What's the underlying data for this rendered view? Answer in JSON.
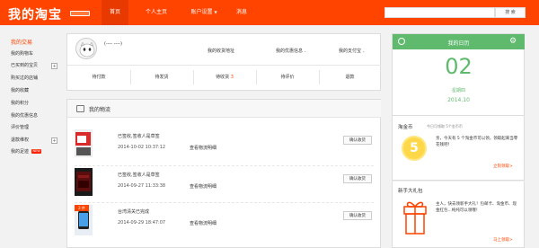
{
  "header": {
    "logo": "我的淘宝",
    "logo_badge": "",
    "nav": [
      {
        "label": "首页",
        "active": true
      },
      {
        "label": "个人主页",
        "active": false
      },
      {
        "label": "账户设置",
        "active": false
      },
      {
        "label": "消息",
        "active": false
      }
    ],
    "search_button": "搜 索",
    "search_value": ""
  },
  "sidebar": {
    "title": "我的交易",
    "items": [
      {
        "label": "我的购物车"
      },
      {
        "label": "已买到的宝贝"
      },
      {
        "label": "购买过的店铺"
      },
      {
        "label": "我的收藏"
      },
      {
        "label": "我的积分"
      },
      {
        "label": "我的优惠信息"
      },
      {
        "label": "评价管理"
      },
      {
        "label": "退款维权"
      },
      {
        "label": "我的足迹"
      }
    ],
    "new_badge": "NEW"
  },
  "profile": {
    "username": "(---- ----)",
    "links": [
      "我的收货地址",
      "我的优惠信息",
      "我的支付宝"
    ],
    "orders": [
      {
        "label": "待付款",
        "count": ""
      },
      {
        "label": "待发货",
        "count": ""
      },
      {
        "label": "待收货",
        "count": "3"
      },
      {
        "label": "待评价",
        "count": ""
      },
      {
        "label": "退款",
        "count": ""
      }
    ]
  },
  "logistics": {
    "title": "我的物流",
    "items": [
      {
        "status": "已签收,签收人是草签",
        "time": "2014-10-02 10:37:12",
        "link": "查看物流明细",
        "button": "确认收货",
        "badge": ""
      },
      {
        "status": "已签收,签收人是草签",
        "time": "2014-09-27 11:33:38",
        "link": "查看物流明细",
        "button": "确认收货",
        "badge": ""
      },
      {
        "status": "台湾清关已完成",
        "time": "2014-09-29 18:47:07",
        "link": "查看物流明细",
        "button": "确认收货",
        "badge": "2 件"
      }
    ]
  },
  "calendar": {
    "title": "我的日历",
    "day": "02",
    "weekday": "星期四",
    "month": "2014.10"
  },
  "coins": {
    "title": "淘金币",
    "meta": "今日可领取   5个金币币",
    "amount": "5",
    "text": "亲，今天有 5 个淘金币可以领，领取起来当零花钱吧！",
    "link": "立刻领取>"
  },
  "gift": {
    "title": "新手大礼包",
    "text": "主人，快去领新手大礼！包邮卡、淘金币、现金红包...纯纯可以领哦！",
    "link": "马上领取>"
  },
  "colors": {
    "brand": "#ff4400",
    "calendar_green": "#5fba6e",
    "coin": "#ffd84a"
  }
}
